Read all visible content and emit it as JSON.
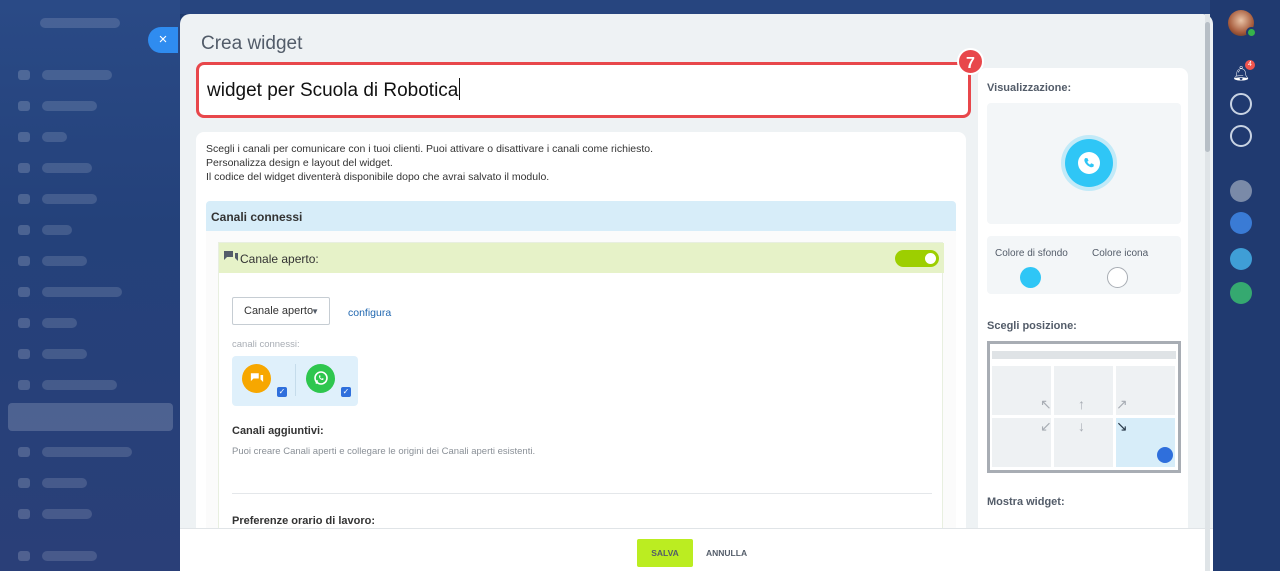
{
  "panel": {
    "title": "Crea widget",
    "close_glyph": "×",
    "step_badge": "7"
  },
  "name_input": {
    "value": "widget per Scuola di Robotica"
  },
  "intro": {
    "line1": "Scegli i canali per comunicare con i tuoi clienti. Puoi attivare o disattivare i canali come richiesto.",
    "line2": "Personalizza design e layout del widget.",
    "line3": "Il codice del widget diventerà disponibile dopo che avrai salvato il modulo."
  },
  "connected_channels": {
    "header": "Canali connessi",
    "open_channel": {
      "title": "Canale aperto:",
      "enabled": true,
      "select_value": "Canale aperto",
      "configure_link": "configura",
      "connected_label": "canali connessi:",
      "channels": [
        {
          "icon": "chat-bubbles-icon",
          "color": "#f7a700",
          "checked": true
        },
        {
          "icon": "whatsapp-icon",
          "color": "#2ec64e",
          "checked": true
        }
      ],
      "extra_title": "Canali aggiuntivi:",
      "extra_desc": "Puoi creare Canali aperti e collegare le origini dei Canali aperti esistenti.",
      "hours_title": "Preferenze orario di lavoro:"
    }
  },
  "sidebar": {
    "preview_label": "Visualizzazione:",
    "bg_color_label": "Colore di sfondo",
    "icon_color_label": "Colore icona",
    "bg_color": "#2fc6f6",
    "icon_color": "#ffffff",
    "position_label": "Scegli posizione:",
    "selected_position": "bottom-right",
    "show_widget_label": "Mostra widget:"
  },
  "footer": {
    "save_label": "SALVA",
    "cancel_label": "ANNULLA"
  },
  "rail": {
    "notification_count": "4"
  },
  "colors": {
    "accent_red": "#e8474b",
    "save_green": "#bbed21",
    "toggle_green": "#9dcf00",
    "section_blue": "#d7edf9",
    "widget_blue": "#2fc6f6"
  }
}
